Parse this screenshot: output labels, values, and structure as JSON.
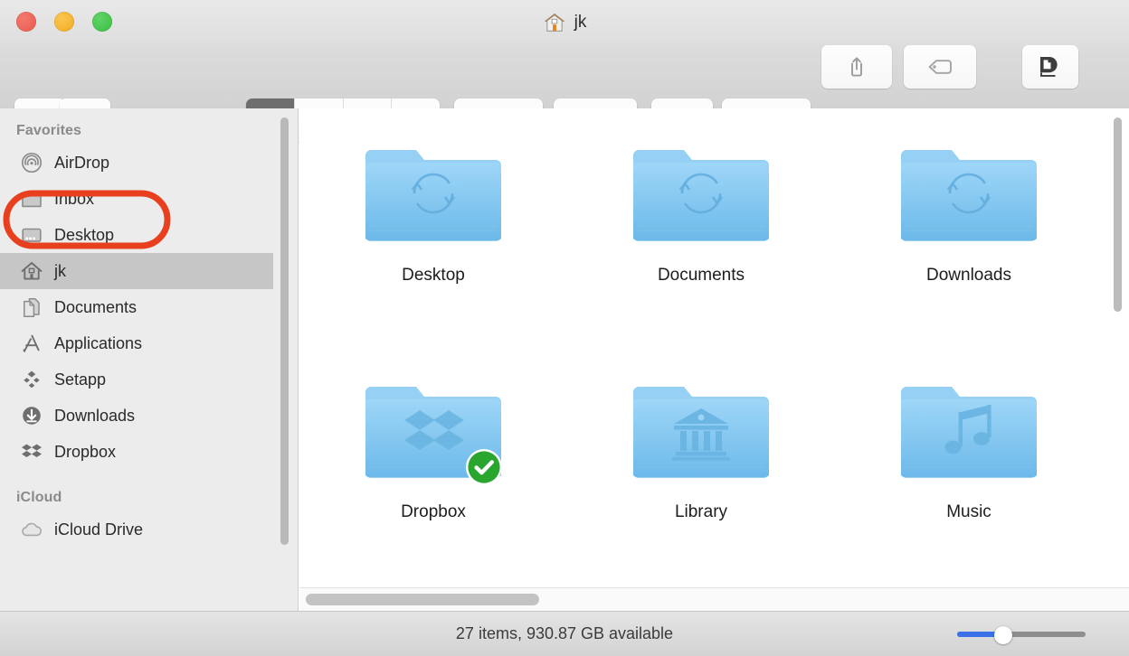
{
  "window": {
    "title": "jk",
    "title_icon": "home-folder-icon",
    "traffic_lights": [
      {
        "name": "close",
        "color": "#e8594c"
      },
      {
        "name": "minimize",
        "color": "#f0ab1d"
      },
      {
        "name": "maximize",
        "color": "#37bf41"
      }
    ]
  },
  "toolbar": {
    "back_icon": "chevron-left-icon",
    "forward_icon": "chevron-right-icon",
    "view_modes": [
      {
        "name": "icon-view",
        "icon": "grid-icon",
        "selected": true
      },
      {
        "name": "list-view",
        "icon": "list-icon",
        "selected": false
      },
      {
        "name": "column-view",
        "icon": "columns-icon",
        "selected": false
      },
      {
        "name": "gallery-view",
        "icon": "gallery-icon",
        "selected": false
      }
    ],
    "arrange_icon": "arrange-grid-icon",
    "action_icon": "gear-icon",
    "devonthink_icon": "devonthink-icon",
    "dropbox_icon": "dropbox-icon",
    "share_icon": "share-icon",
    "tag_icon": "tag-icon",
    "devonthink_sorter_icon": "devonthink-sorter-icon",
    "overflow_icon": "double-chevron-right-icon",
    "chevron_icon": "chevron-down-icon"
  },
  "sidebar": {
    "sections": [
      {
        "header": "Favorites",
        "items": [
          {
            "label": "AirDrop",
            "icon": "airdrop-icon",
            "selected": false,
            "highlighted": false
          },
          {
            "label": "Inbox",
            "icon": "folder-icon",
            "selected": false,
            "highlighted": true
          },
          {
            "label": "Desktop",
            "icon": "desktop-icon",
            "selected": false,
            "highlighted": false
          },
          {
            "label": "jk",
            "icon": "home-icon",
            "selected": true,
            "highlighted": false
          },
          {
            "label": "Documents",
            "icon": "documents-icon",
            "selected": false,
            "highlighted": false
          },
          {
            "label": "Applications",
            "icon": "applications-icon",
            "selected": false,
            "highlighted": false
          },
          {
            "label": "Setapp",
            "icon": "setapp-icon",
            "selected": false,
            "highlighted": false
          },
          {
            "label": "Downloads",
            "icon": "downloads-icon",
            "selected": false,
            "highlighted": false
          },
          {
            "label": "Dropbox",
            "icon": "dropbox-icon",
            "selected": false,
            "highlighted": false
          }
        ]
      },
      {
        "header": "iCloud",
        "items": [
          {
            "label": "iCloud Drive",
            "icon": "cloud-icon",
            "selected": false,
            "highlighted": false
          }
        ]
      }
    ]
  },
  "content": {
    "items": [
      {
        "label": "Desktop",
        "emblem": "sync-arrows-emblem",
        "badge": null
      },
      {
        "label": "Documents",
        "emblem": "sync-arrows-emblem",
        "badge": null
      },
      {
        "label": "Downloads",
        "emblem": "sync-arrows-emblem",
        "badge": null
      },
      {
        "label": "Dropbox",
        "emblem": "dropbox-emblem",
        "badge": "green-check-badge"
      },
      {
        "label": "Library",
        "emblem": "columns-building-emblem",
        "badge": null
      },
      {
        "label": "Music",
        "emblem": "music-note-emblem",
        "badge": null
      }
    ]
  },
  "status": {
    "text": "27 items, 930.87 GB available",
    "zoom_slider_value": 33
  },
  "annotation": {
    "shape": "ellipse",
    "target": "Inbox",
    "color": "#e8401f"
  },
  "colors": {
    "folder_blue": "#7cc3f0",
    "accent_blue": "#3b71e8",
    "annotation_red": "#e8401f",
    "badge_green": "#2aa62f"
  }
}
